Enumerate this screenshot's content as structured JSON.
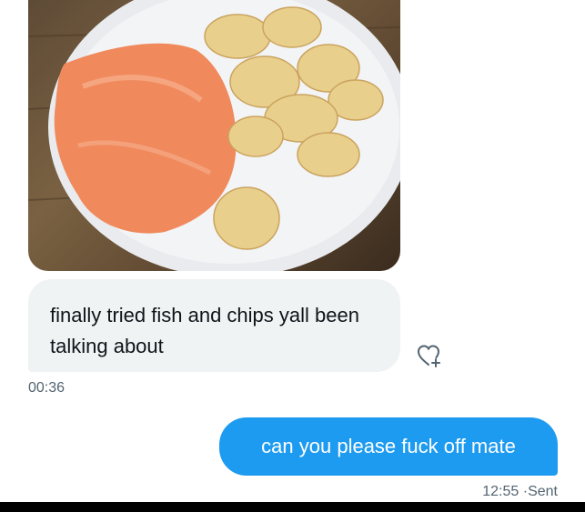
{
  "received": {
    "message": "finally tried fish and chips yall been talking about",
    "time": "00:36"
  },
  "sent": {
    "message": "can you please fuck off mate",
    "time": "12:55",
    "separator": "·",
    "status": "Sent"
  },
  "icons": {
    "react": "heart-plus-icon"
  },
  "colors": {
    "sent_bubble": "#1d9bf0",
    "received_bubble": "#eff3f4",
    "meta_text": "#536471"
  }
}
